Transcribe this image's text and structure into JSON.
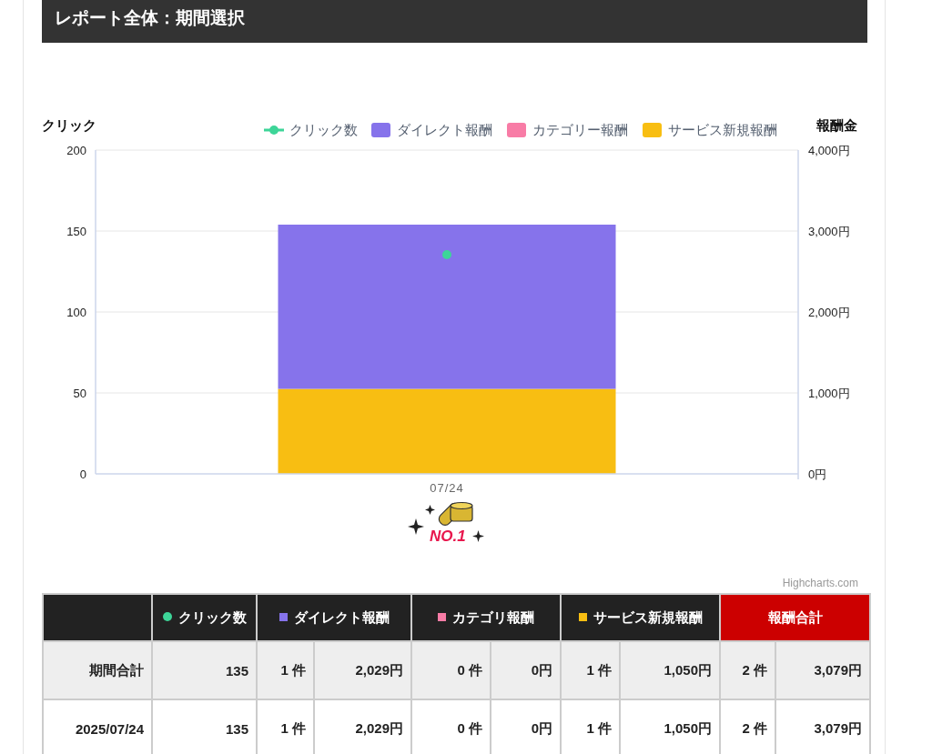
{
  "title": "レポート全体：期間選択",
  "chart": {
    "chart_data": {
      "type": "bar",
      "stacked": true,
      "grid": true,
      "legend": "top",
      "ylabel": "報酬金",
      "categories": [
        "07/24"
      ],
      "ylim": [
        0,
        4000
      ],
      "yticks": [
        {
          "value": 0,
          "label": "0円"
        },
        {
          "value": 1000,
          "label": "1,000円"
        },
        {
          "value": 2000,
          "label": "2,000円"
        },
        {
          "value": 3000,
          "label": "3,000円"
        },
        {
          "value": 4000,
          "label": "4,000円"
        }
      ],
      "series": [
        {
          "name": "ダイレクト報酬",
          "color": "#8673eb",
          "values": [
            2029
          ]
        },
        {
          "name": "カテゴリー報酬",
          "color": "#f87ca6",
          "values": [
            0
          ]
        },
        {
          "name": "サービス新規報酬",
          "color": "#f8be12",
          "values": [
            1050
          ]
        }
      ]
    },
    "click_axis": {
      "title": "クリック",
      "ticks": [
        "200",
        "150",
        "100",
        "50",
        "0"
      ]
    },
    "click_series": {
      "name": "クリック数",
      "color": "#3dd598"
    },
    "badge": "NO.1",
    "credit": "Highcharts.com"
  },
  "table": {
    "columns": [
      {
        "label": "クリック数",
        "color": "#3dd598",
        "kind": "single"
      },
      {
        "label": "ダイレクト報酬",
        "color": "#8673eb",
        "kind": "pair",
        "colspan": 2
      },
      {
        "label": "カテゴリ報酬",
        "color": "#f87ca6",
        "kind": "pair",
        "colspan": 2
      },
      {
        "label": "サービス新規報酬",
        "color": "#f8be12",
        "kind": "pair",
        "colspan": 2
      },
      {
        "label": "報酬合計",
        "kind": "total",
        "colspan": 2
      }
    ],
    "rows": [
      {
        "label": "期間合計",
        "kind": "summary",
        "cells": [
          "135",
          "1 件",
          "2,029円",
          "0 件",
          "0円",
          "1 件",
          "1,050円",
          "2 件",
          "3,079円"
        ]
      },
      {
        "label": "2025/07/24",
        "kind": "day",
        "cells": [
          "135",
          "1 件",
          "2,029円",
          "0 件",
          "0円",
          "1 件",
          "1,050円",
          "2 件",
          "3,079円"
        ]
      }
    ]
  }
}
